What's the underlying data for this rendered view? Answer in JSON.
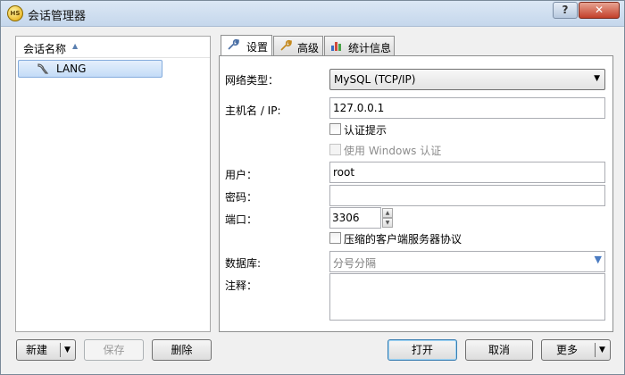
{
  "window": {
    "title": "会话管理器",
    "app_icon": "app-logo-icon",
    "help_label": "?",
    "close_label": "✕"
  },
  "sessions": {
    "column_header": "会话名称",
    "items": [
      {
        "label": "LANG",
        "icon": "mysql-dolphin-icon"
      }
    ]
  },
  "tabs": [
    {
      "label": "设置",
      "icon": "wrench-icon",
      "active": true
    },
    {
      "label": "高级",
      "icon": "wrench-icon",
      "active": false
    },
    {
      "label": "统计信息",
      "icon": "bar-chart-icon",
      "active": false
    }
  ],
  "settings": {
    "network_type_label": "网络类型：",
    "network_type_value": "MySQL (TCP/IP)",
    "hostname_label": "主机名 / IP:",
    "hostname_value": "127.0.0.1",
    "auth_prompt_label": "认证提示",
    "windows_auth_label": "使用 Windows 认证",
    "user_label": "用户：",
    "user_value": "root",
    "password_label": "密码：",
    "password_value": "",
    "port_label": "端口：",
    "port_value": "3306",
    "compressed_label": "压缩的客户端服务器协议",
    "database_label": "数据库:",
    "database_placeholder": "分号分隔",
    "notes_label": "注释：",
    "notes_value": ""
  },
  "buttons": {
    "new": "新建",
    "save": "保存",
    "delete": "删除",
    "open": "打开",
    "cancel": "取消",
    "more": "更多"
  }
}
